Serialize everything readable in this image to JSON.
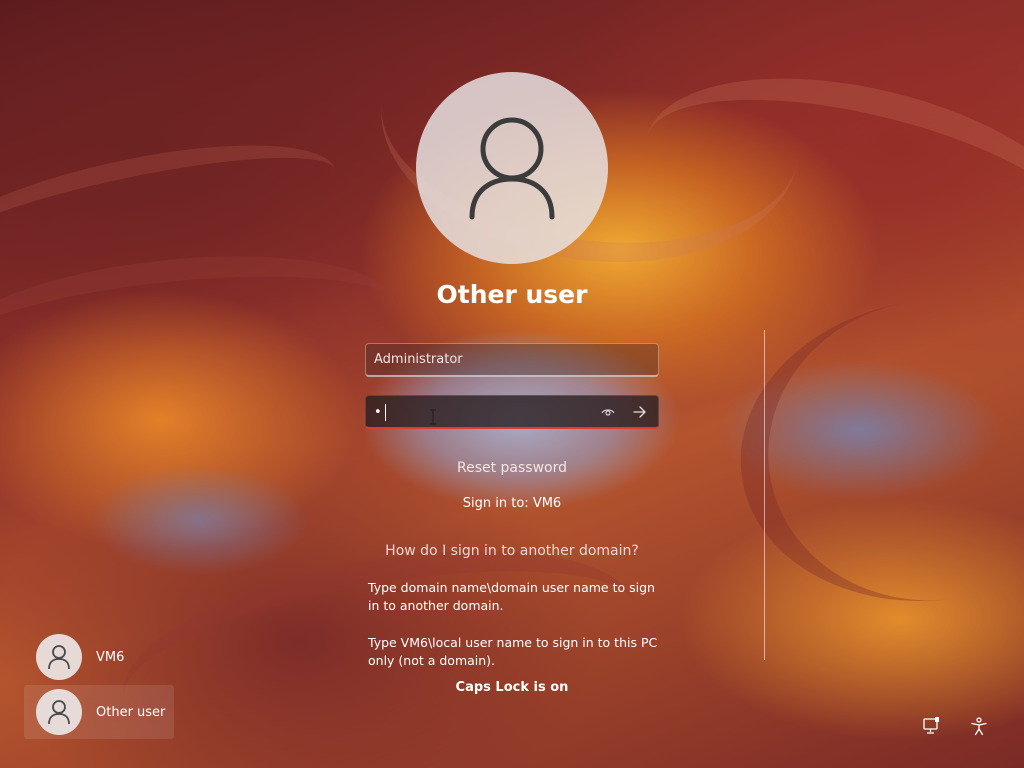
{
  "login": {
    "user_title": "Other user",
    "username_value": "Administrator",
    "password_value": "•",
    "reset_password_label": "Reset password",
    "sign_in_to": "Sign in to: VM6",
    "domain_help_link": "How do I sign in to another domain?",
    "help_text_1": "Type domain name\\domain user name to sign in to another domain.",
    "help_text_2": "Type VM6\\local user name to sign in to this PC only (not a domain).",
    "caps_lock_warning": "Caps Lock is on"
  },
  "user_list": [
    {
      "name": "VM6",
      "icon": "user-icon"
    },
    {
      "name": "Other user",
      "icon": "user-icon",
      "selected": true
    }
  ],
  "tray": {
    "network_icon": "network-icon",
    "accessibility_icon": "accessibility-icon"
  },
  "icons": {
    "reveal_password": "eye-icon",
    "submit": "arrow-right-icon"
  },
  "colors": {
    "password_focus_underline": "#e23a2c"
  }
}
